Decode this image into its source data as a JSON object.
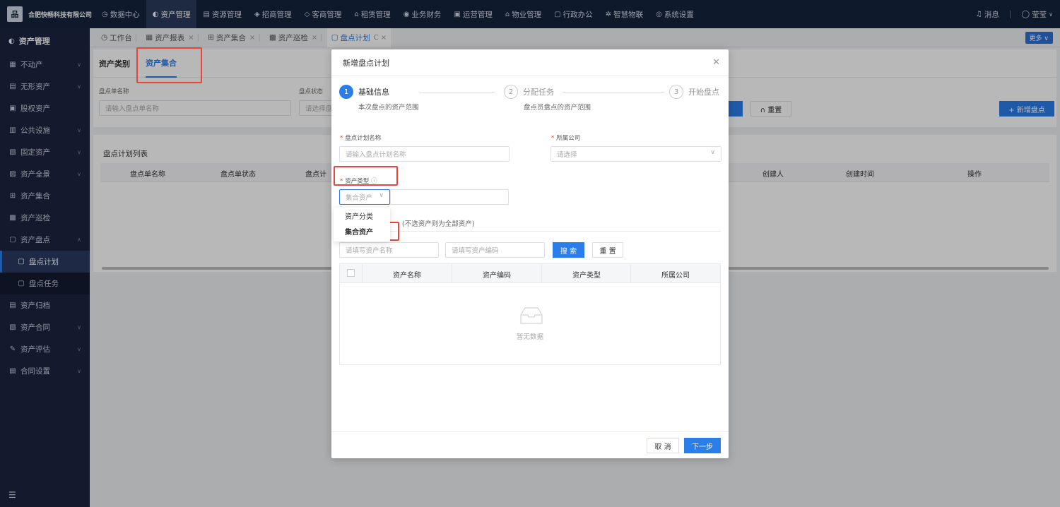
{
  "topbar": {
    "company": "合肥快畅科技有限公司",
    "logo_glyph": "品",
    "nav": [
      {
        "icon": "◷",
        "label": "数据中心"
      },
      {
        "icon": "◐",
        "label": "资产管理",
        "active": true
      },
      {
        "icon": "▤",
        "label": "资源管理"
      },
      {
        "icon": "◈",
        "label": "招商管理"
      },
      {
        "icon": "◇",
        "label": "客商管理"
      },
      {
        "icon": "⌂",
        "label": "租赁管理"
      },
      {
        "icon": "◉",
        "label": "业务财务"
      },
      {
        "icon": "▣",
        "label": "运营管理"
      },
      {
        "icon": "⌂",
        "label": "物业管理"
      },
      {
        "icon": "▢",
        "label": "行政办公"
      },
      {
        "icon": "✲",
        "label": "智慧物联"
      },
      {
        "icon": "◎",
        "label": "系统设置"
      }
    ],
    "messages_label": "消息",
    "user_name": "莹莹"
  },
  "sidebar": {
    "title": "资产管理",
    "items": [
      {
        "icon": "▦",
        "label": "不动产",
        "arrow": "∨"
      },
      {
        "icon": "▤",
        "label": "无形资产",
        "arrow": "∨"
      },
      {
        "icon": "▣",
        "label": "股权资产",
        "arrow": ""
      },
      {
        "icon": "▥",
        "label": "公共设施",
        "arrow": "∨"
      },
      {
        "icon": "▧",
        "label": "固定资产",
        "arrow": "∨"
      },
      {
        "icon": "▨",
        "label": "资产全景",
        "arrow": "∨"
      },
      {
        "icon": "⊞",
        "label": "资产集合",
        "arrow": ""
      },
      {
        "icon": "▩",
        "label": "资产巡检",
        "arrow": ""
      },
      {
        "icon": "▢",
        "label": "资产盘点",
        "arrow": "∧"
      },
      {
        "icon": "▢",
        "label": "盘点计划",
        "sub": true,
        "active": true
      },
      {
        "icon": "▢",
        "label": "盘点任务",
        "sub": true
      },
      {
        "icon": "▤",
        "label": "资产归档",
        "arrow": ""
      },
      {
        "icon": "▧",
        "label": "资产合同",
        "arrow": "∨"
      },
      {
        "icon": "✎",
        "label": "资产评估",
        "arrow": "∨"
      },
      {
        "icon": "▤",
        "label": "合同设置",
        "arrow": "∨"
      }
    ]
  },
  "tabs": [
    {
      "icon": "◷",
      "label": "工作台",
      "close": ""
    },
    {
      "icon": "▦",
      "label": "资产报表",
      "close": "×"
    },
    {
      "icon": "⊞",
      "label": "资产集合",
      "close": "×"
    },
    {
      "icon": "▩",
      "label": "资产巡检",
      "close": "×"
    },
    {
      "icon": "▢",
      "label": "盘点计划",
      "close": "C ×",
      "active": true
    }
  ],
  "more_label": "更多 ∨",
  "page": {
    "subtabs": [
      "资产类别",
      "资产集合"
    ],
    "filter1_label": "盘点单名称",
    "filter1_placeholder": "请输入盘点单名称",
    "filter2_label": "盘点状态",
    "filter2_placeholder": "请选择盘",
    "reset_label": "∩ 重置",
    "new_label": "+ 新增盘点",
    "list_title": "盘点计划列表",
    "columns": [
      "盘点单名称",
      "盘点单状态",
      "盘点计",
      "创建人",
      "创建时间",
      "操作"
    ]
  },
  "modal": {
    "title": "新增盘点计划",
    "steps": [
      {
        "num": "1",
        "title": "基础信息",
        "desc": "本次盘点的资产范围"
      },
      {
        "num": "2",
        "title": "分配任务",
        "desc": "盘点员盘点的资产范围"
      },
      {
        "num": "3",
        "title": "开始盘点",
        "desc": ""
      }
    ],
    "plan_name_label": "盘点计划名称",
    "plan_name_placeholder": "请输入盘点计划名称",
    "company_label": "所属公司",
    "company_placeholder": "请选择",
    "asset_type_label": "资产类型",
    "asset_type_value": "集合资产",
    "dropdown_options": [
      "资产分类",
      "集合资产"
    ],
    "hint": "(不选资产则为全部资产)",
    "asset_name_placeholder": "请填写资产名称",
    "asset_code_placeholder": "请填写资产编码",
    "search_label": "搜 索",
    "reset_label": "重 置",
    "table_columns": [
      "资产名称",
      "资产编码",
      "资产类型",
      "所属公司"
    ],
    "empty_text": "暂无数据",
    "cancel_label": "取 消",
    "next_label": "下一步"
  },
  "colors": {
    "primary": "#2b7de9",
    "topbar": "#16233d",
    "sidebar": "#1b2540",
    "highlight": "#e8453c"
  }
}
